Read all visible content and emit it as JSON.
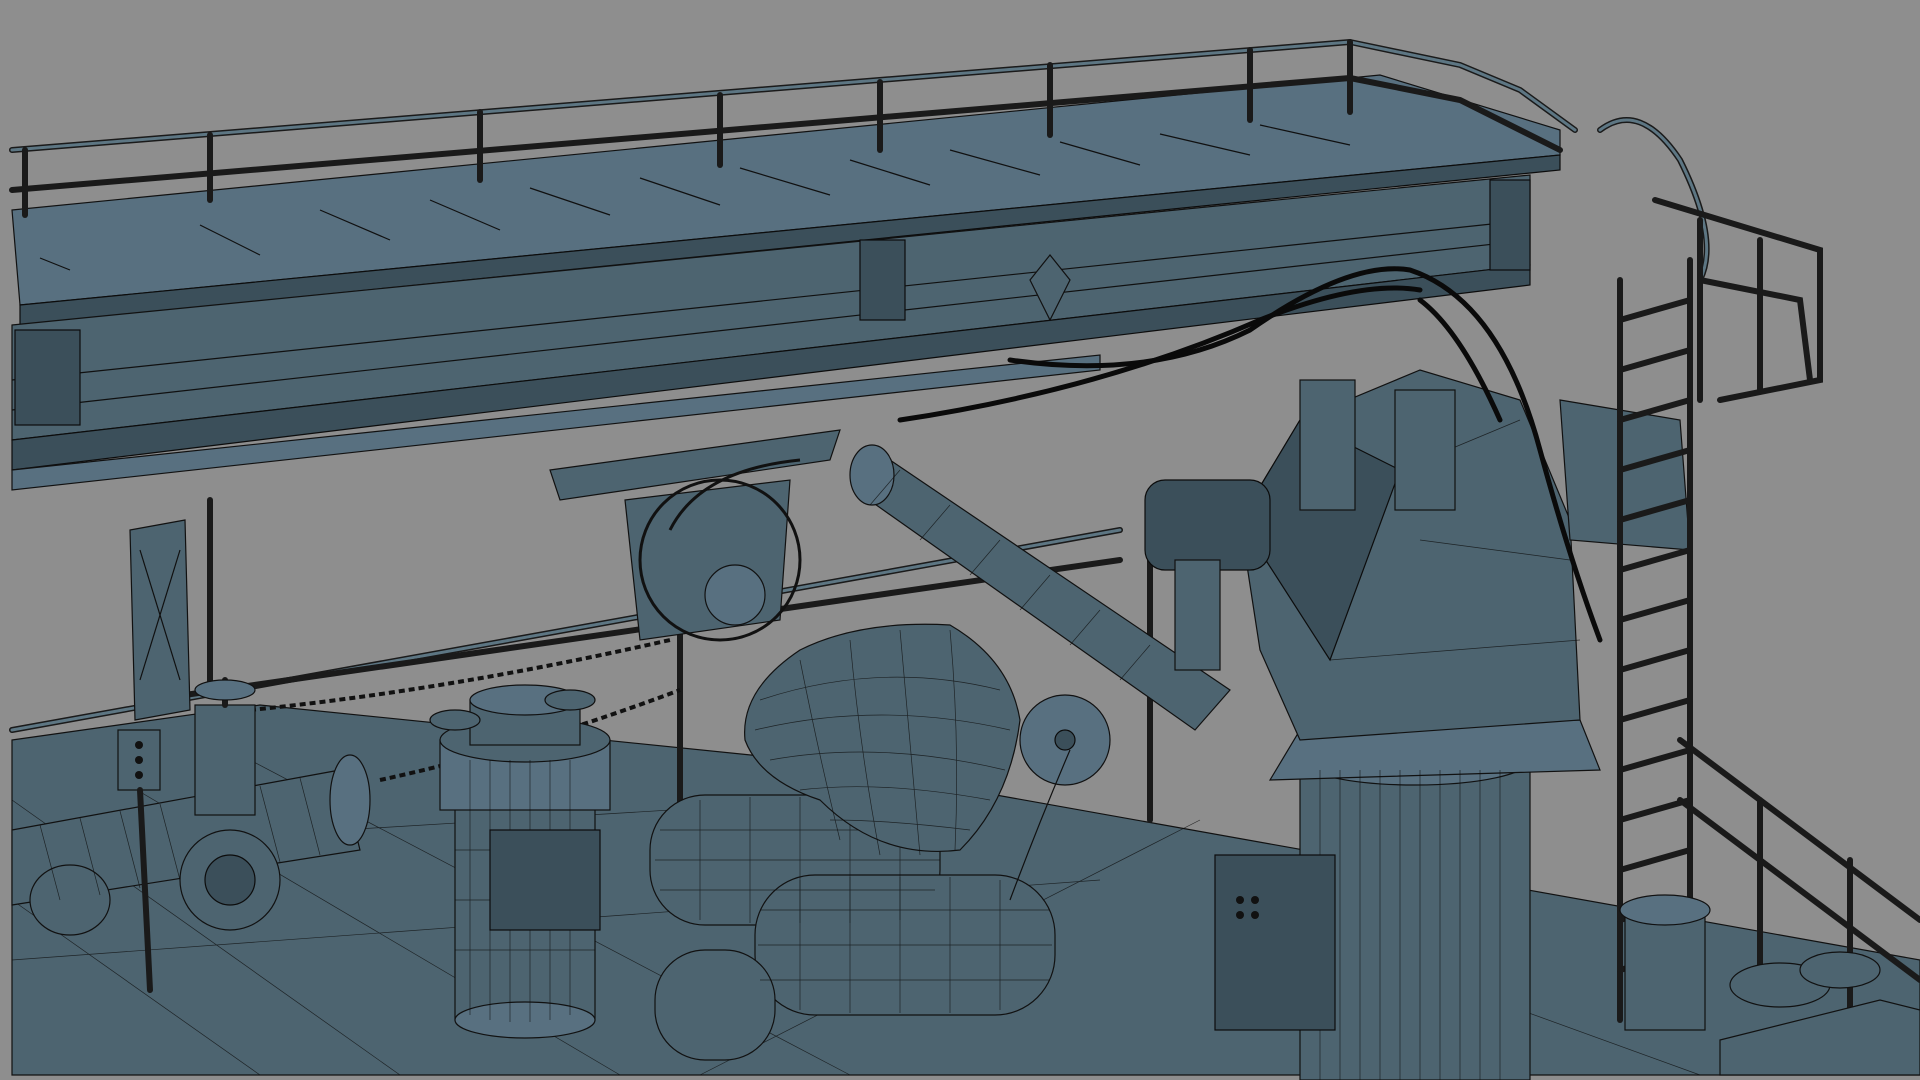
{
  "viewport": {
    "mode": "wireframe-on-shaded",
    "background_color": "#8e8e8e",
    "model_color": "#4d6470",
    "wire_color": "#111111"
  }
}
